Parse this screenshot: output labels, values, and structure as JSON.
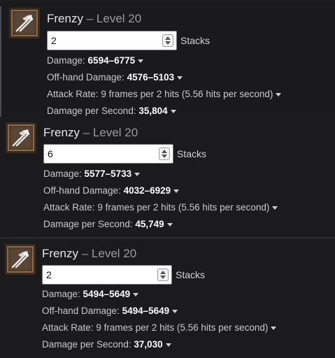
{
  "panels": [
    {
      "skill_name": "Frenzy",
      "separator": "–",
      "level_label": "Level 20",
      "stacks_value": "2",
      "stacks_label": "Stacks",
      "damage_label": "Damage:",
      "damage_value": "6594–6775",
      "offhand_label": "Off-hand Damage:",
      "offhand_value": "4576–5103",
      "attack_rate_label": "Attack Rate:",
      "attack_rate_value": "9 frames per 2 hits (5.56 hits per second)",
      "dps_label": "Damage per Second:",
      "dps_value": "35,804",
      "icon": "crossed-axes-icon"
    },
    {
      "skill_name": "Frenzy",
      "separator": "–",
      "level_label": "Level 20",
      "stacks_value": "6",
      "stacks_label": "Stacks",
      "damage_label": "Damage:",
      "damage_value": "5577–5733",
      "offhand_label": "Off-hand Damage:",
      "offhand_value": "4032–6929",
      "attack_rate_label": "Attack Rate:",
      "attack_rate_value": "9 frames per 2 hits (5.56 hits per second)",
      "dps_label": "Damage per Second:",
      "dps_value": "45,749",
      "icon": "crossed-axes-icon"
    },
    {
      "skill_name": "Frenzy",
      "separator": "–",
      "level_label": "Level 20",
      "stacks_value": "2",
      "stacks_label": "Stacks",
      "damage_label": "Damage:",
      "damage_value": "5494–5649",
      "offhand_label": "Off-hand Damage:",
      "offhand_value": "5494–5649",
      "attack_rate_label": "Attack Rate:",
      "attack_rate_value": "9 frames per 2 hits (5.56 hits per second)",
      "dps_label": "Damage per Second:",
      "dps_value": "37,030",
      "icon": "crossed-axes-icon"
    }
  ],
  "colors": {
    "background": "#19191b",
    "value_text": "#ffffff",
    "label_text": "#c9c9c9",
    "icon_frame": "#5a4634"
  }
}
